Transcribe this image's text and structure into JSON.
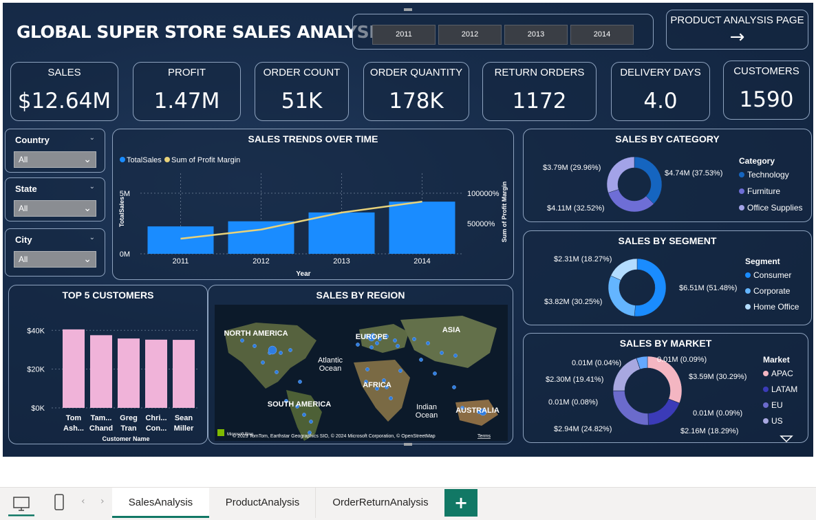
{
  "header": {
    "title": "GLOBAL SUPER STORE SALES ANALYSIS"
  },
  "years": [
    "2011",
    "2012",
    "2013",
    "2014"
  ],
  "nav_button": {
    "label": "PRODUCT ANALYSIS PAGE",
    "arrow": "→"
  },
  "kpis": [
    {
      "label": "SALES",
      "value": "$12.64M"
    },
    {
      "label": "PROFIT",
      "value": "1.47M"
    },
    {
      "label": "ORDER COUNT",
      "value": "51K"
    },
    {
      "label": "ORDER QUANTITY",
      "value": "178K"
    },
    {
      "label": "RETURN ORDERS",
      "value": "1172"
    },
    {
      "label": "DELIVERY DAYS",
      "value": "4.0"
    },
    {
      "label": "CUSTOMERS",
      "value": "1590"
    }
  ],
  "slicers": [
    {
      "label": "Country",
      "value": "All"
    },
    {
      "label": "State",
      "value": "All"
    },
    {
      "label": "City",
      "value": "All"
    }
  ],
  "colors": {
    "bar_blue": "#1a8cff",
    "profit_line": "#e8d27a",
    "pink": "#f0b3d9",
    "tech": "#1565c0",
    "furniture": "#6e6ed6",
    "office": "#a3a3e8",
    "consumer": "#1a8cff",
    "corporate": "#64b5ff",
    "home_office": "#b3dcff",
    "apac": "#f4b6c2",
    "latam": "#3b3bb8",
    "eu": "#6b6bcc",
    "us": "#a8a8e0",
    "tab_active": "#117865"
  },
  "chart_data": [
    {
      "type": "bar",
      "title": "SALES TRENDS OVER TIME",
      "categories": [
        "2011",
        "2012",
        "2013",
        "2014"
      ],
      "series": [
        {
          "name": "TotalSales",
          "values": [
            2.26,
            2.68,
            3.41,
            4.3
          ]
        },
        {
          "name": "Sum of Profit Margin",
          "values": [
            250000,
            400000,
            680000,
            860000
          ]
        }
      ],
      "xlabel": "Year",
      "ylabel": "TotalSales",
      "y2label": "Sum of Profit Margin",
      "y_ticks": [
        "0M",
        "5M"
      ],
      "y2_ticks": [
        "50000%",
        "100000%"
      ],
      "ylim": [
        0,
        5.5
      ],
      "y2lim": [
        0,
        1100000
      ]
    },
    {
      "type": "bar",
      "title": "TOP 5 CUSTOMERS",
      "categories": [
        "Tom Ash...",
        "Tam... Chand",
        "Greg Tran",
        "Chri... Con...",
        "Sean Miller"
      ],
      "values": [
        40.5,
        37.5,
        35.8,
        35.2,
        35.1
      ],
      "xlabel": "Customer Name",
      "y_ticks": [
        "$0K",
        "$20K",
        "$40K"
      ],
      "ylim": [
        0,
        44
      ]
    },
    {
      "type": "pie",
      "title": "SALES BY CATEGORY",
      "legend_title": "Category",
      "labels": [
        "Technology",
        "Furniture",
        "Office Supplies"
      ],
      "values": [
        4.74,
        4.11,
        3.79
      ],
      "data_labels": [
        "$4.74M (37.53%)",
        "$4.11M (32.52%)",
        "$3.79M (29.96%)"
      ]
    },
    {
      "type": "pie",
      "title": "SALES BY SEGMENT",
      "legend_title": "Segment",
      "labels": [
        "Consumer",
        "Corporate",
        "Home Office"
      ],
      "values": [
        6.51,
        3.82,
        2.31
      ],
      "data_labels": [
        "$6.51M (51.48%)",
        "$3.82M (30.25%)",
        "$2.31M (18.27%)"
      ]
    },
    {
      "type": "pie",
      "title": "SALES BY MARKET",
      "legend_title": "Market",
      "labels": [
        "APAC",
        "LATAM",
        "EU",
        "US"
      ],
      "values": [
        3.59,
        2.16,
        2.94,
        2.3,
        0.01,
        0.01,
        0.01,
        0.01
      ],
      "data_labels": [
        "$3.59M (30.29%)",
        "$2.16M (18.29%)",
        "$2.94M (24.82%)",
        "$2.30M (19.41%)",
        "0.01M (0.09%)",
        "0.01M (0.09%)",
        "0.01M (0.08%)",
        "0.01M (0.04%)"
      ]
    }
  ],
  "map": {
    "title": "SALES BY REGION",
    "labels": [
      "NORTH AMERICA",
      "EUROPE",
      "ASIA",
      "AFRICA",
      "SOUTH AMERICA",
      "AUSTRALIA",
      "Atlantic Ocean",
      "Indian Ocean"
    ],
    "attribution": "© 2023 TomTom, Earthstar Geographics SIO, © 2024 Microsoft Corporation, © OpenStreetMap",
    "terms": "Terms",
    "brand": "Microsoft Bing"
  },
  "tabs": [
    {
      "label": "SalesAnalysis",
      "active": true
    },
    {
      "label": "ProductAnalysis"
    },
    {
      "label": "OrderReturnAnalysis"
    }
  ],
  "add_tab": "+"
}
